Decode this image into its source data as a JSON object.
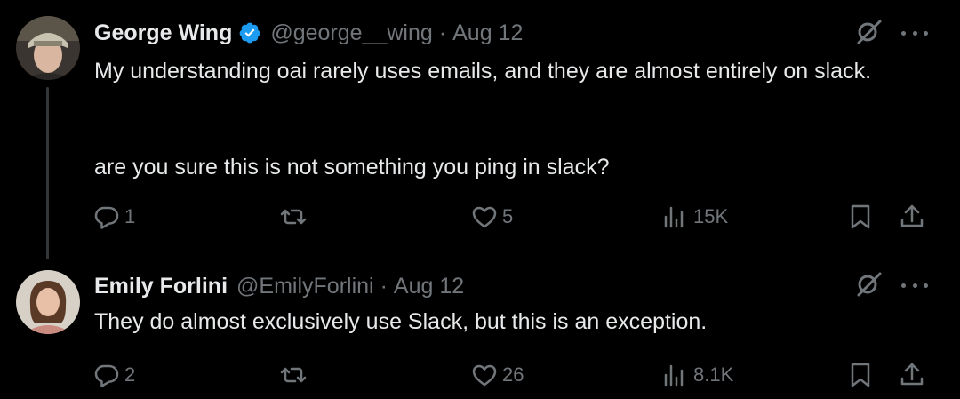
{
  "tweets": [
    {
      "display_name": "George Wing",
      "verified": true,
      "handle": "@george__wing",
      "separator": "·",
      "date": "Aug 12",
      "text_lines": [
        "My understanding oai rarely uses emails, and they are almost entirely on slack.",
        "are you sure this is not something you ping in slack?"
      ],
      "replies": "1",
      "retweets": "",
      "likes": "5",
      "views": "15K"
    },
    {
      "display_name": "Emily Forlini",
      "verified": false,
      "handle": "@EmilyForlini",
      "separator": "·",
      "date": "Aug 12",
      "text_lines": [
        "They do almost exclusively use Slack, but this is an exception."
      ],
      "replies": "2",
      "retweets": "",
      "likes": "26",
      "views": "8.1K"
    }
  ],
  "icons": {
    "reply": "reply-icon",
    "retweet": "retweet-icon",
    "like": "heart-icon",
    "views": "views-icon",
    "bookmark": "bookmark-icon",
    "share": "share-icon",
    "grok": "grok-icon",
    "more": "more-icon",
    "verified": "verified-badge-icon"
  },
  "colors": {
    "background": "#000000",
    "text": "#e7e9ea",
    "secondary": "#71767b",
    "verified": "#1d9bf0",
    "thread_line": "#333639"
  }
}
